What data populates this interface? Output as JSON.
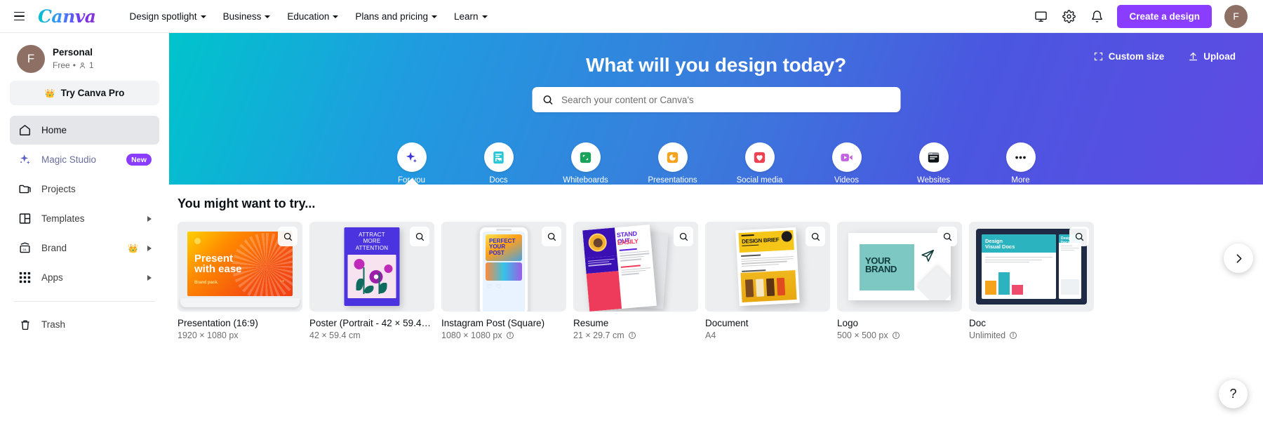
{
  "topnav": {
    "menu_icon": "hamburger-icon",
    "logo_text": "Canva",
    "links": [
      {
        "label": "Design spotlight",
        "has_caret": true
      },
      {
        "label": "Business",
        "has_caret": true
      },
      {
        "label": "Education",
        "has_caret": true
      },
      {
        "label": "Plans and pricing",
        "has_caret": true
      },
      {
        "label": "Learn",
        "has_caret": true
      }
    ],
    "icons": [
      {
        "name": "monitor-icon"
      },
      {
        "name": "gear-icon"
      },
      {
        "name": "bell-icon"
      }
    ],
    "create_button": "Create a design",
    "avatar_initial": "F"
  },
  "sidebar": {
    "account": {
      "avatar_initial": "F",
      "name": "Personal",
      "plan": "Free",
      "separator": "•",
      "members": "1"
    },
    "pro_button": {
      "label": "Try Canva Pro",
      "icon": "crown-icon"
    },
    "items": [
      {
        "label": "Home",
        "icon": "home-icon",
        "active": true,
        "badge": "",
        "chevron": false
      },
      {
        "label": "Magic Studio",
        "icon": "sparkle-icon",
        "active": false,
        "badge": "New",
        "chevron": false
      },
      {
        "label": "Projects",
        "icon": "folder-icon",
        "active": false,
        "badge": "",
        "chevron": false
      },
      {
        "label": "Templates",
        "icon": "layout-icon",
        "active": false,
        "badge": "",
        "chevron": true
      },
      {
        "label": "Brand",
        "icon": "brand-icon",
        "active": false,
        "badge": "",
        "chevron": true,
        "crown": true
      },
      {
        "label": "Apps",
        "icon": "apps-grid-icon",
        "active": false,
        "badge": "",
        "chevron": true
      }
    ],
    "trash": {
      "label": "Trash",
      "icon": "trash-icon"
    }
  },
  "hero": {
    "title": "What will you design today?",
    "actions": [
      {
        "label": "Custom size",
        "icon": "custom-size-icon"
      },
      {
        "label": "Upload",
        "icon": "upload-icon"
      }
    ],
    "search": {
      "placeholder": "Search your content or Canva's",
      "value": "",
      "icon": "search-icon"
    },
    "categories": [
      {
        "label": "For you",
        "icon": "sparkle-icon",
        "active": true
      },
      {
        "label": "Docs",
        "icon": "docs-icon",
        "active": false
      },
      {
        "label": "Whiteboards",
        "icon": "whiteboard-icon",
        "active": false
      },
      {
        "label": "Presentations",
        "icon": "presentation-icon",
        "active": false
      },
      {
        "label": "Social media",
        "icon": "heart-icon",
        "active": false
      },
      {
        "label": "Videos",
        "icon": "video-icon",
        "active": false
      },
      {
        "label": "Websites",
        "icon": "website-icon",
        "active": false
      },
      {
        "label": "More",
        "icon": "more-icon",
        "active": false
      }
    ]
  },
  "main": {
    "section_title": "You might want to try...",
    "cards": [
      {
        "title": "Presentation (16:9)",
        "dimensions": "1920 × 1080 px",
        "art": "presentation",
        "has_pro": false
      },
      {
        "title": "Poster (Portrait - 42 × 59.4 ...",
        "dimensions": "42 × 59.4 cm",
        "art": "poster",
        "has_pro": false
      },
      {
        "title": "Instagram Post (Square)",
        "dimensions": "1080 × 1080 px",
        "art": "instagram",
        "has_pro": true
      },
      {
        "title": "Resume",
        "dimensions": "21 × 29.7 cm",
        "art": "resume",
        "has_pro": true
      },
      {
        "title": "Document",
        "dimensions": "A4",
        "art": "document",
        "has_pro": false
      },
      {
        "title": "Logo",
        "dimensions": "500 × 500 px",
        "art": "logo",
        "has_pro": true
      },
      {
        "title": "Doc",
        "dimensions": "Unlimited",
        "art": "doc",
        "has_pro": true
      }
    ],
    "help_button": "?",
    "carousel_next": "next-arrow-icon"
  },
  "colors": {
    "brand_purple": "#8b3dff",
    "avatar_brown": "#8d6f64",
    "hero_gradient_start": "#00c4cc",
    "hero_gradient_end": "#5f4ae3",
    "sidebar_active": "#e4e6e9"
  }
}
